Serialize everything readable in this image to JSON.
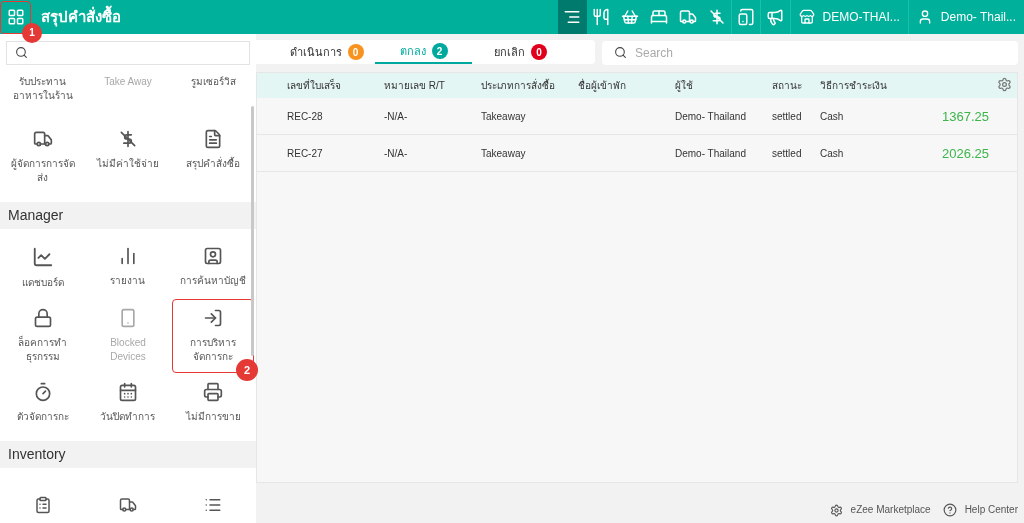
{
  "header": {
    "title": "สรุปคำสั่งซื้อ",
    "apps_callout": "1",
    "toolbar": [
      {
        "selected": true
      },
      {
        "selected": false
      },
      {
        "selected": false
      },
      {
        "selected": false
      },
      {
        "selected": false
      },
      {
        "selected": false
      },
      {
        "selected": false
      },
      {
        "selected": false
      }
    ],
    "store": "DEMO-THAI...",
    "user": "Demo- Thail..."
  },
  "drawer": {
    "groups": [
      {
        "items": [
          {
            "label": "รับประทาน\nอาหารในร้าน",
            "disabled": false,
            "highlighted": false
          },
          {
            "label": "Take Away",
            "disabled": true,
            "highlighted": false
          },
          {
            "label": "รูมเซอร์วิส",
            "disabled": false,
            "highlighted": false
          }
        ]
      },
      {
        "items": [
          {
            "label": "ผู้จัดการการจัด\nส่ง",
            "disabled": false,
            "highlighted": false
          },
          {
            "label": "ไม่มีค่าใช้จ่าย",
            "disabled": false,
            "highlighted": false
          },
          {
            "label": "สรุปคำสั่งซื้อ",
            "disabled": false,
            "highlighted": false
          }
        ]
      },
      {
        "title": "Manager",
        "items": [
          {
            "label": "แดชบอร์ด",
            "disabled": false,
            "highlighted": false
          },
          {
            "label": "รายงาน",
            "disabled": false,
            "highlighted": false
          },
          {
            "label": "การค้นหาบัญชี",
            "disabled": false,
            "highlighted": false
          },
          {
            "label": "ล็อคการทำ\nธุรกรรม",
            "disabled": false,
            "highlighted": false
          },
          {
            "label": "Blocked\nDevices",
            "disabled": true,
            "highlighted": false
          },
          {
            "label": "การบริหาร\nจัดการกะ",
            "disabled": false,
            "highlighted": true,
            "callout": "2"
          },
          {
            "label": "ตัวจัดการกะ",
            "disabled": false,
            "highlighted": false
          },
          {
            "label": "วันปิดทำการ",
            "disabled": false,
            "highlighted": false
          },
          {
            "label": "ไม่มีการขาย",
            "disabled": false,
            "highlighted": false
          }
        ]
      },
      {
        "title": "Inventory"
      }
    ]
  },
  "tabs": [
    {
      "label": "ดำเนินการ",
      "count": "0",
      "color": "#f7931e",
      "selected": false
    },
    {
      "label": "ตกลง",
      "count": "2",
      "color": "#00a99d",
      "selected": true
    },
    {
      "label": "ยกเลิก",
      "count": "0",
      "color": "#e0001b",
      "selected": false
    }
  ],
  "search": {
    "placeholder": "Search"
  },
  "table": {
    "columns": [
      "เลขที่ใบเสร็จ",
      "หมายเลข R/T",
      "ประเภทการสั่งซื้อ",
      "ชื่อผู้เข้าพัก",
      "ผู้ใช้",
      "สถานะ",
      "วิธีการชำระเงิน"
    ],
    "rows": [
      {
        "cells": [
          "REC-28",
          "-N/A-",
          "Takeaway",
          "",
          "Demo- Thailand",
          "settled",
          "Cash"
        ],
        "amount": "1367.25"
      },
      {
        "cells": [
          "REC-27",
          "-N/A-",
          "Takeaway",
          "",
          "Demo- Thailand",
          "settled",
          "Cash"
        ],
        "amount": "2026.25"
      }
    ]
  },
  "footer": {
    "marketplace": "eZee Marketplace",
    "help": "Help Center"
  }
}
